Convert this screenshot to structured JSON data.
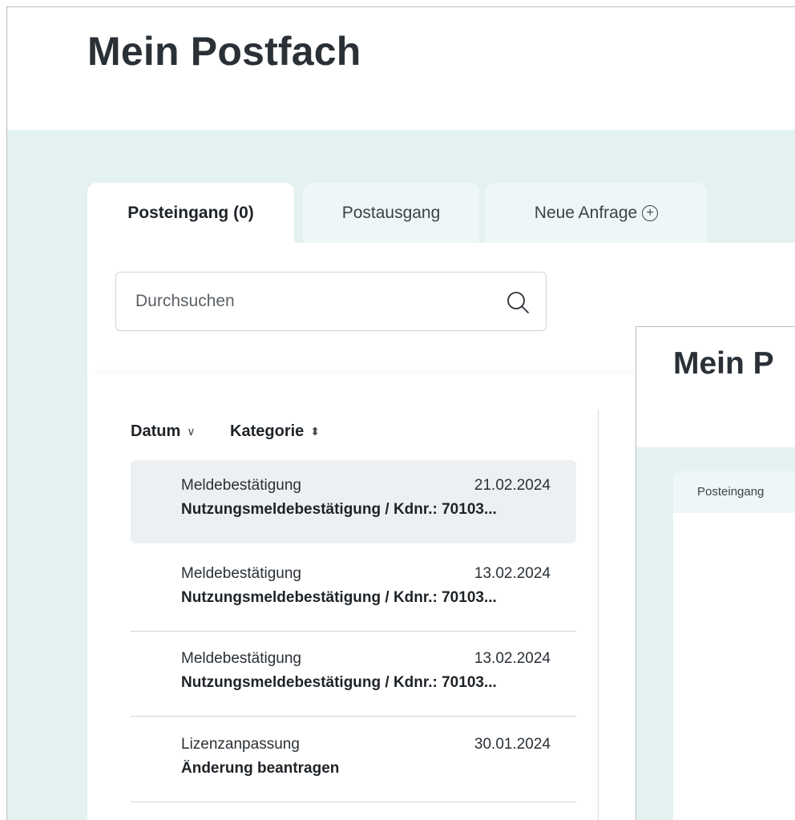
{
  "page": {
    "title": "Mein Postfach"
  },
  "tabs": [
    {
      "label": "Posteingang (0)"
    },
    {
      "label": "Postausgang"
    },
    {
      "label": "Neue Anfrage"
    }
  ],
  "search": {
    "placeholder": "Durchsuchen",
    "icon": "search-icon"
  },
  "sort": {
    "date_label": "Datum",
    "category_label": "Kategorie"
  },
  "messages": [
    {
      "category": "Meldebestätigung",
      "date": "21.02.2024",
      "subject": "Nutzungsmeldebestätigung / Kdnr.: 70103..."
    },
    {
      "category": "Meldebestätigung",
      "date": "13.02.2024",
      "subject": "Nutzungsmeldebestätigung / Kdnr.: 70103..."
    },
    {
      "category": "Meldebestätigung",
      "date": "13.02.2024",
      "subject": "Nutzungsmeldebestätigung / Kdnr.: 70103..."
    },
    {
      "category": "Lizenzanpassung",
      "date": "30.01.2024",
      "subject": "Änderung beantragen"
    }
  ],
  "overlay": {
    "title": "Mein P",
    "tab_label": "Posteingang"
  },
  "colors": {
    "background_band": "#e4f1f1",
    "selected_row": "#edf0f3",
    "text": "#1e2328"
  }
}
